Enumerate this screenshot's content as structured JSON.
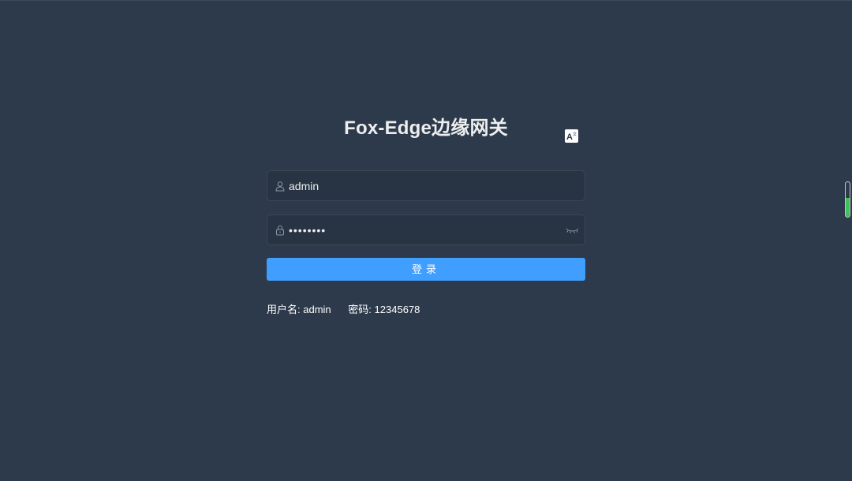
{
  "title": "Fox-Edge边缘网关",
  "lang_switch": {
    "icon": "translate-icon",
    "glyph": "A"
  },
  "username": {
    "value": "admin",
    "icon": "user-icon"
  },
  "password": {
    "value": "12345678",
    "masked": "••••••••",
    "icon": "lock-icon",
    "toggle_icon": "eye-closed-icon"
  },
  "login_button": {
    "label": "登录"
  },
  "tips": {
    "username_label": "用户名:",
    "username_value": "admin",
    "password_label": "密码:",
    "password_value": "12345678"
  },
  "side_indicator": {
    "level": 0.55
  },
  "colors": {
    "background": "#2d3a4b",
    "field": "#283443",
    "accent": "#409eff",
    "indicator": "#3fc05a"
  }
}
